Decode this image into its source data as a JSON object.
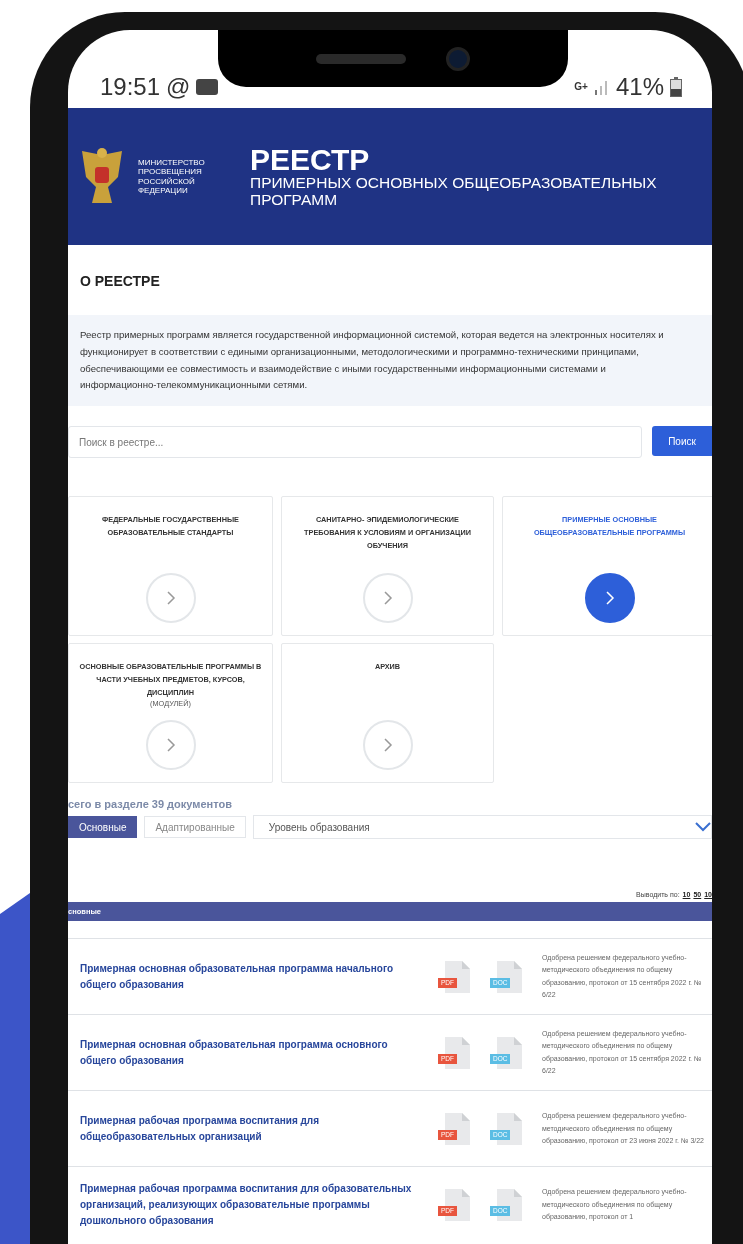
{
  "status_bar": {
    "time": "19:51",
    "at_sign": "@",
    "network": "G+",
    "battery": "41%"
  },
  "header": {
    "ministry": "МИНИСТЕРСТВО ПРОСВЕЩЕНИЯ РОССИЙСКОЙ ФЕДЕРАЦИИ",
    "title": "РЕЕСТР",
    "subtitle": "ПРИМЕРНЫХ ОСНОВНЫХ ОБЩЕОБРАЗОВАТЕЛЬНЫХ ПРОГРАММ"
  },
  "about": {
    "title": "О РЕЕСТРЕ",
    "text": "Реестр примерных программ является государственной информационной системой, которая ведется на электронных носителях и функционирует в соответствии с едиными организационными, методологическими и программно-техническими принципами, обеспечивающими ее совместимость и взаимодействие с иными государственными информационными системами и информационно-телекоммуникационными сетями."
  },
  "search": {
    "placeholder": "Поиск в реестре...",
    "button": "Поиск"
  },
  "sections": [
    {
      "title": "ФЕДЕРАЛЬНЫЕ ГОСУДАРСТВЕННЫЕ ОБРАЗОВАТЕЛЬНЫЕ СТАНДАРТЫ",
      "selected": false
    },
    {
      "title": "САНИТАРНО- ЭПИДЕМИОЛОГИЧЕСКИЕ ТРЕБОВАНИЯ К УСЛОВИЯМ И ОРГАНИЗАЦИИ ОБУЧЕНИЯ",
      "selected": false
    },
    {
      "title": "ПРИМЕРНЫЕ ОСНОВНЫЕ ОБЩЕОБРАЗОВАТЕЛЬНЫЕ ПРОГРАММЫ",
      "selected": true
    },
    {
      "title": "ОСНОВНЫЕ ОБРАЗОВАТЕЛЬНЫЕ ПРОГРАММЫ В ЧАСТИ УЧЕБНЫХ ПРЕДМЕТОВ, КУРСОВ, ДИСЦИПЛИН",
      "note": "(МОДУЛЕЙ)",
      "selected": false
    },
    {
      "title": "АРХИВ",
      "selected": false
    }
  ],
  "count": "сего в разделе 39 документов",
  "tabs": [
    {
      "label": "Основные",
      "selected": true
    },
    {
      "label": "Адаптированные",
      "selected": false
    }
  ],
  "level_select": {
    "value": "Уровень образования"
  },
  "per_page": {
    "label": "Выводить по:",
    "options": [
      "10",
      "50",
      "10"
    ]
  },
  "table": {
    "header": "сновные",
    "rows": [
      {
        "title": "Примерная основная образовательная программа начального общего образования",
        "files": [
          {
            "label": "PDF",
            "color": "#e8553e"
          },
          {
            "label": "DOC",
            "color": "#5bbde4"
          }
        ],
        "note": "Одобрена решением федерального учебно-методического объединения по общему образованию, протокол от 15 сентября 2022 г. № 6/22"
      },
      {
        "title": "Примерная основная образовательная программа основного общего образования",
        "files": [
          {
            "label": "PDF",
            "color": "#e8553e"
          },
          {
            "label": "DOC",
            "color": "#5bbde4"
          }
        ],
        "note": "Одобрена решением федерального учебно-методического объединения по общему образованию, протокол от 15 сентября 2022 г. № 6/22"
      },
      {
        "title": "Примерная рабочая программа воспитания для общеобразовательных организаций",
        "files": [
          {
            "label": "PDF",
            "color": "#e8553e"
          },
          {
            "label": "DOC",
            "color": "#5bbde4"
          }
        ],
        "note": "Одобрена решением федерального учебно-методического объединения по общему образованию, протокол от 23 июня 2022 г. № 3/22"
      },
      {
        "title": "Примерная рабочая программа воспитания для образовательных организаций, реализующих образовательные программы дошкольного образования",
        "files": [
          {
            "label": "PDF",
            "color": "#e8553e"
          },
          {
            "label": "DOC",
            "color": "#5bbde4"
          }
        ],
        "note": "Одобрена решением федерального учебно-методического объединения по общему образованию, протокол от 1"
      }
    ]
  }
}
